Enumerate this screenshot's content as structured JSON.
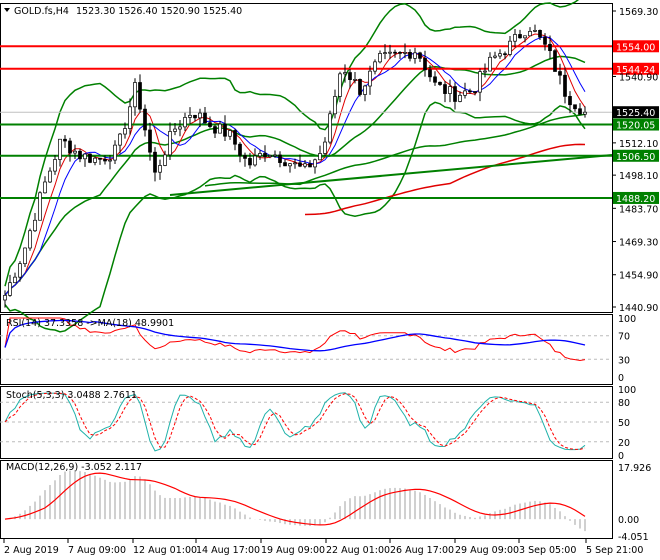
{
  "header": {
    "symbol": "GOLD.fs,H4",
    "ohlc": "1523.30 1526.40 1520.90 1525.40"
  },
  "price_axis": {
    "ticks": [
      "1569.30",
      "1540.90",
      "1512.10",
      "1498.10",
      "1483.70",
      "1469.30",
      "1454.90",
      "1440.90"
    ],
    "range": [
      1440.9,
      1569.3
    ]
  },
  "levels": [
    {
      "label": "1554.00",
      "value": 1554.0,
      "color": "#ff0000"
    },
    {
      "label": "1544.24",
      "value": 1544.24,
      "color": "#ff0000"
    },
    {
      "label": "1520.05",
      "value": 1520.05,
      "color": "#008000"
    },
    {
      "label": "1506.50",
      "value": 1506.5,
      "color": "#008000"
    },
    {
      "label": "1488.20",
      "value": 1488.2,
      "color": "#008000"
    }
  ],
  "current_price": {
    "label": "1525.40",
    "value": 1525.4
  },
  "rsi": {
    "label": "RSI(14) 37.3358  ->MA(18) 48.9901",
    "ticks": [
      "100",
      "70",
      "30",
      "0"
    ]
  },
  "stoch": {
    "label": "Stoch(5,3,3) 3.0488 2.7611",
    "ticks": [
      "100",
      "80",
      "50",
      "20",
      "0"
    ]
  },
  "macd": {
    "label": "MACD(12,26,9) -3.052 2.117",
    "ticks": [
      "17.926",
      "0.00",
      "-4.051"
    ]
  },
  "time_axis": [
    "2 Aug 2019",
    "7 Aug 09:00",
    "12 Aug 01:00",
    "14 Aug 17:00",
    "19 Aug 09:00",
    "22 Aug 01:00",
    "26 Aug 17:00",
    "29 Aug 09:00",
    "3 Sep 05:00",
    "5 Sep 21:00"
  ],
  "chart_data": {
    "type": "candlestick",
    "anchors": [
      1446,
      1465,
      1491.6,
      1513.3,
      1506.8,
      1504.7,
      1509,
      1537,
      1498,
      1517.7,
      1526,
      1519.8,
      1515.5,
      1502.5,
      1509,
      1504.7,
      1500,
      1509,
      1545.9,
      1535,
      1548,
      1550.2,
      1552.4,
      1537,
      1532.9,
      1535,
      1548,
      1554.5,
      1563.2,
      1552.4,
      1532.9,
      1525.4
    ],
    "colors": {
      "bull": "#008000",
      "bear": "#000000",
      "bands": "#008000",
      "ma_slow": "#e00000"
    }
  }
}
